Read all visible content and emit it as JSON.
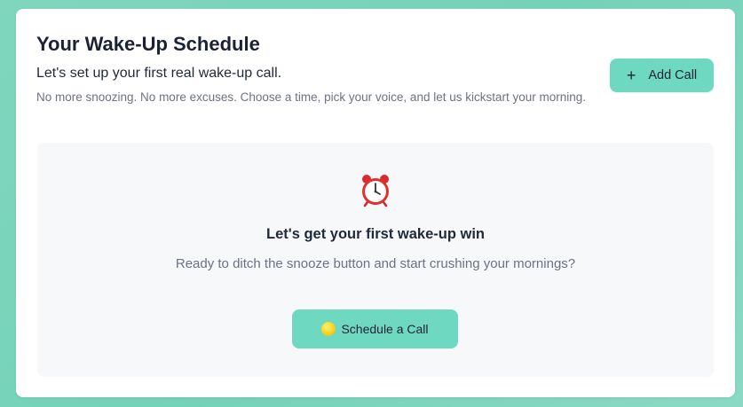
{
  "header": {
    "title": "Your Wake-Up Schedule",
    "subtitle": "Let's set up your first real wake-up call.",
    "description": "No more snoozing. No more excuses. Choose a time, pick your voice, and let us kickstart your morning."
  },
  "actions": {
    "add_icon": "+",
    "add_label": "Add Call"
  },
  "empty_state": {
    "icon": "alarm-clock-icon",
    "title": "Let's get your first wake-up win",
    "text": "Ready to ditch the snooze button and start crushing your mornings?",
    "button_icon": "sun-icon",
    "button_label": "Schedule a Call"
  },
  "colors": {
    "accent": "#6fd8c0",
    "background": "#7fd6bd",
    "card": "#ffffff",
    "panel": "#f7f8fa"
  }
}
